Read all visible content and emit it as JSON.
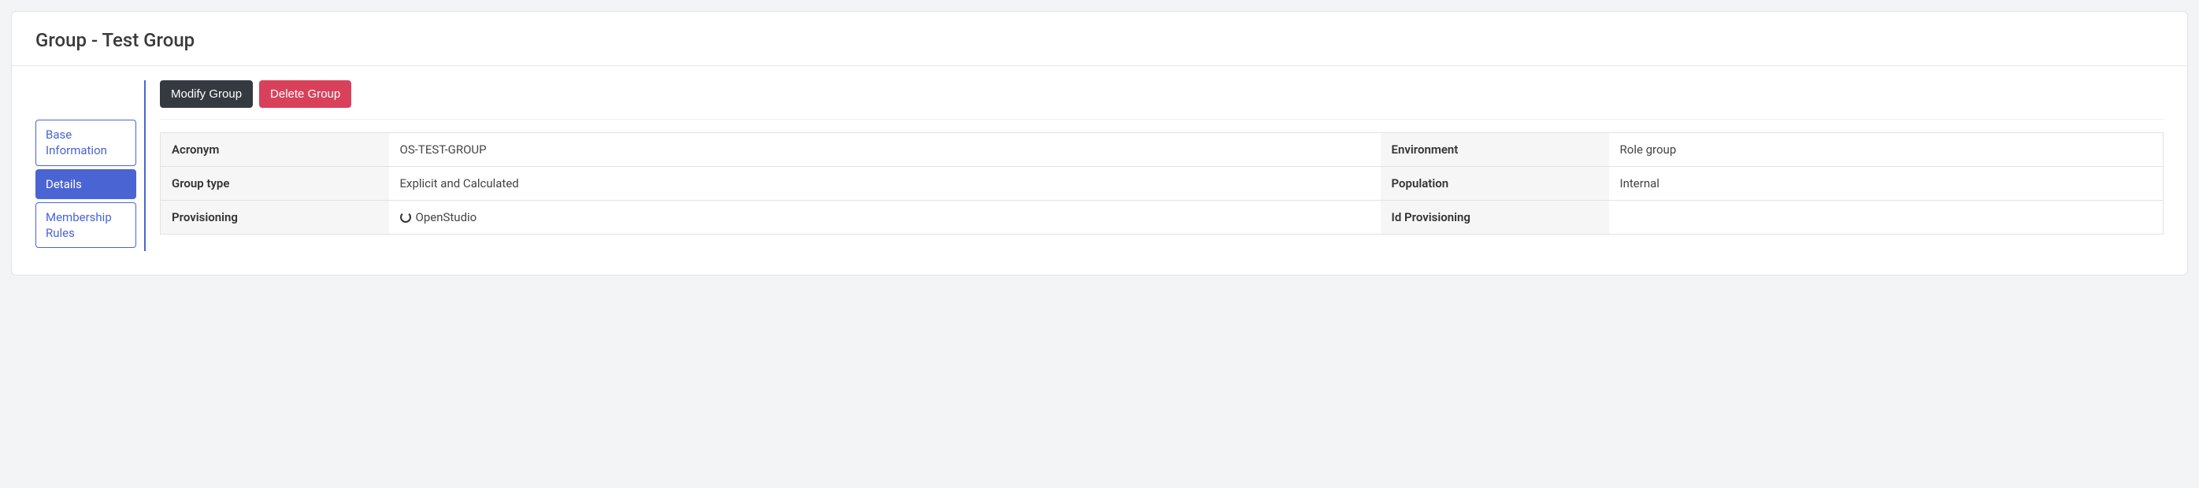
{
  "header": {
    "title": "Group - Test Group"
  },
  "sidebar": {
    "items": [
      {
        "label": "Base Information"
      },
      {
        "label": "Details"
      },
      {
        "label": "Membership Rules"
      }
    ]
  },
  "actions": {
    "modify_label": "Modify Group",
    "delete_label": "Delete Group"
  },
  "details": {
    "rows": [
      {
        "label1": "Acronym",
        "value1": "OS-TEST-GROUP",
        "label2": "Environment",
        "value2": "Role group"
      },
      {
        "label1": "Group type",
        "value1": "Explicit and Calculated",
        "label2": "Population",
        "value2": "Internal"
      },
      {
        "label1": "Provisioning",
        "value1": "OpenStudio",
        "label2": "Id Provisioning",
        "value2": ""
      }
    ]
  }
}
